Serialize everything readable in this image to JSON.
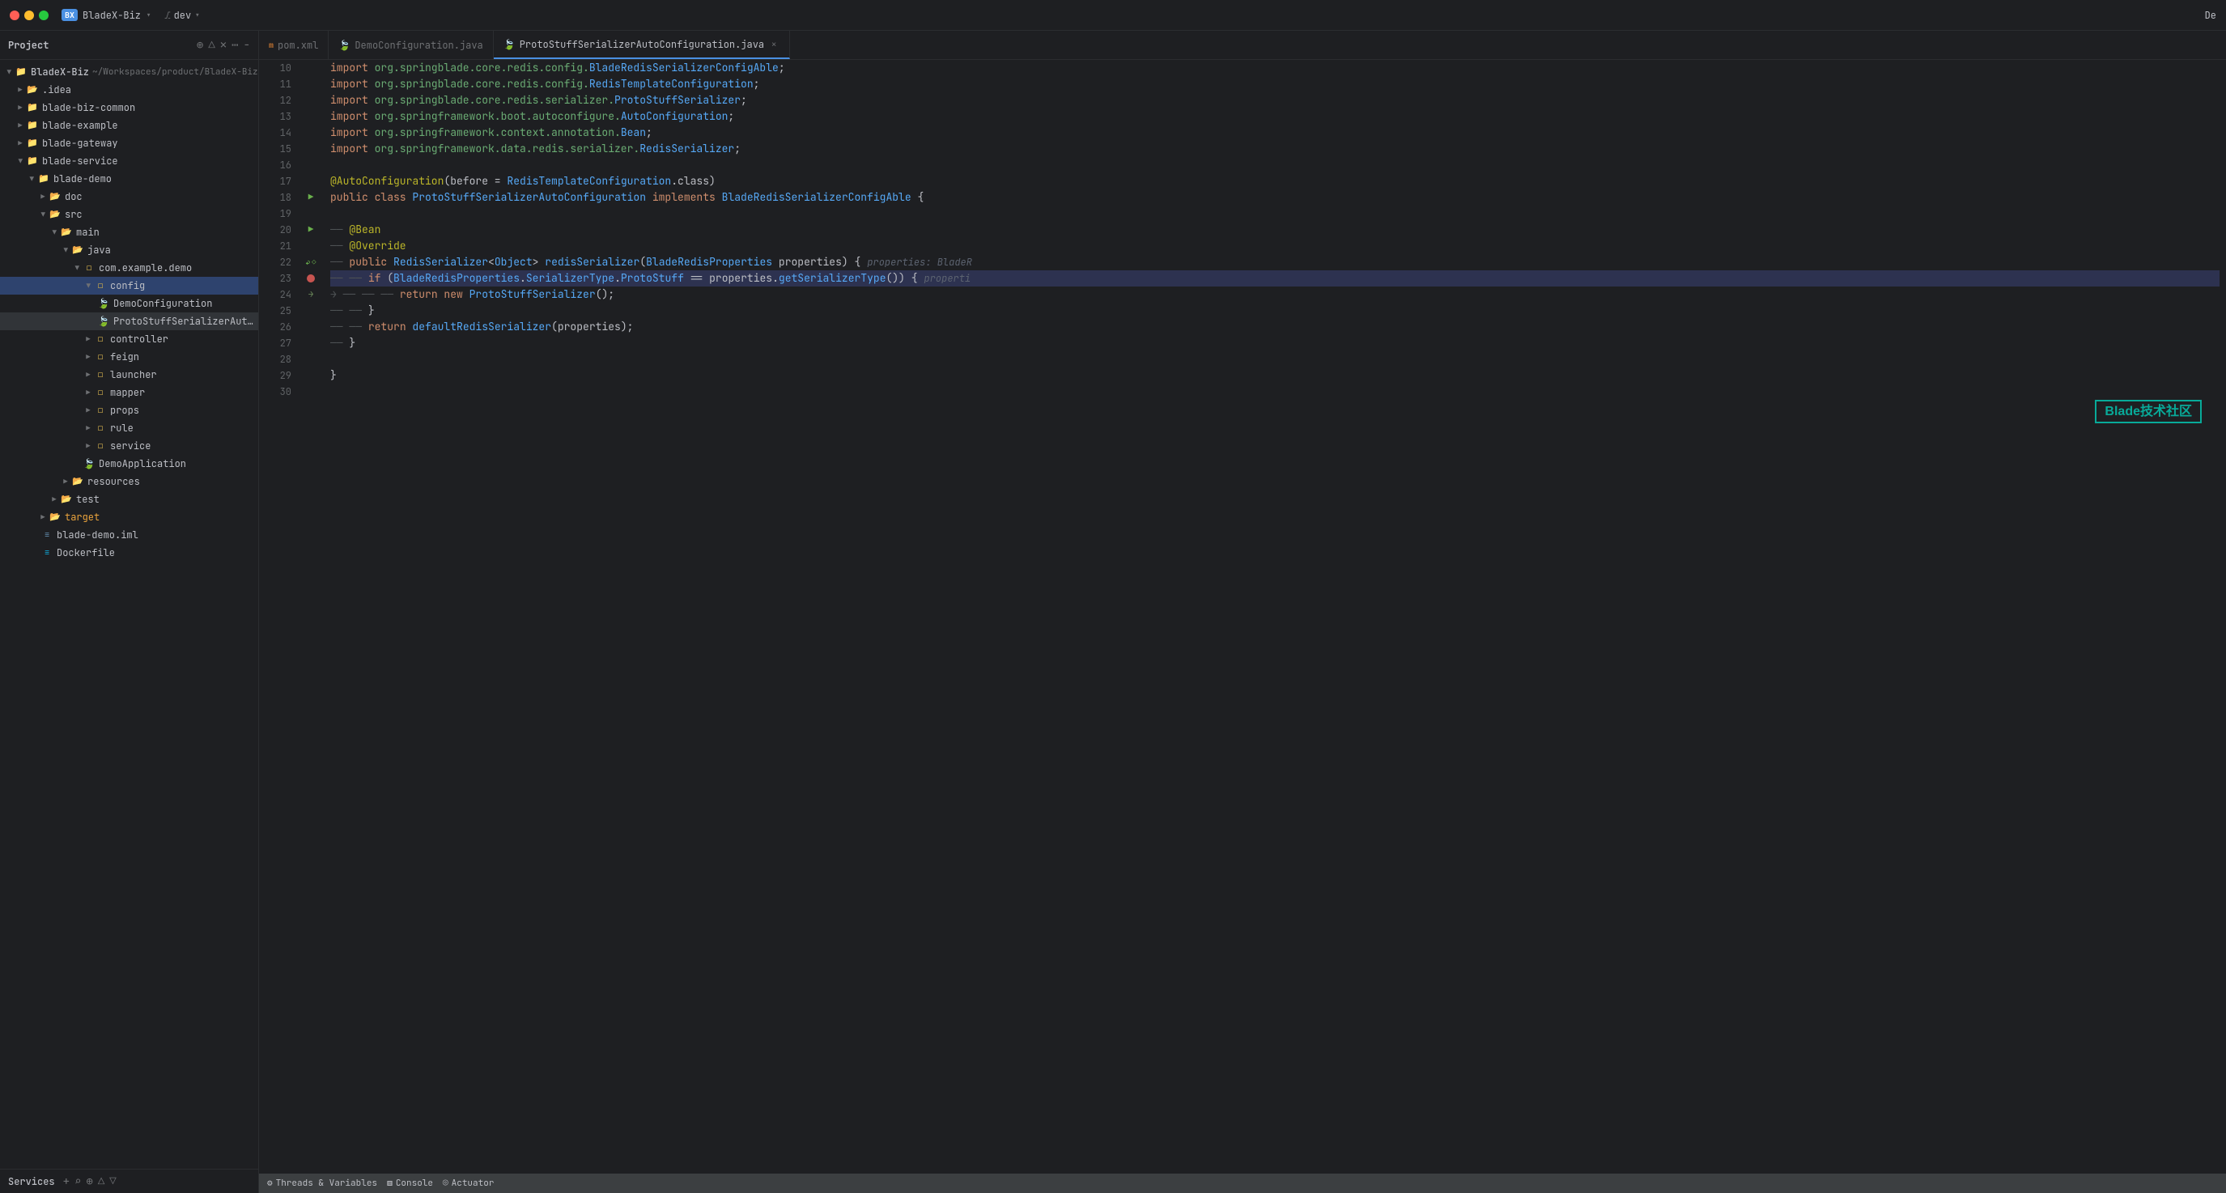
{
  "titlebar": {
    "project_name": "BladeX-Biz",
    "branch": "dev",
    "badge": "BX",
    "right_label": "De"
  },
  "sidebar": {
    "title": "Project",
    "root": {
      "name": "BladeX-Biz",
      "path": "~/Workspaces/product/BladeX-Biz"
    },
    "items": [
      {
        "id": "idea",
        "label": ".idea",
        "type": "folder",
        "depth": 1,
        "expanded": false
      },
      {
        "id": "blade-biz-common",
        "label": "blade-biz-common",
        "type": "module",
        "depth": 1,
        "expanded": false
      },
      {
        "id": "blade-example",
        "label": "blade-example",
        "type": "module",
        "depth": 1,
        "expanded": false
      },
      {
        "id": "blade-gateway",
        "label": "blade-gateway",
        "type": "module",
        "depth": 1,
        "expanded": false
      },
      {
        "id": "blade-service",
        "label": "blade-service",
        "type": "module",
        "depth": 1,
        "expanded": true
      },
      {
        "id": "blade-demo",
        "label": "blade-demo",
        "type": "module",
        "depth": 2,
        "expanded": true
      },
      {
        "id": "doc",
        "label": "doc",
        "type": "folder",
        "depth": 3,
        "expanded": false
      },
      {
        "id": "src",
        "label": "src",
        "type": "folder",
        "depth": 3,
        "expanded": true
      },
      {
        "id": "main",
        "label": "main",
        "type": "folder",
        "depth": 4,
        "expanded": true
      },
      {
        "id": "java",
        "label": "java",
        "type": "folder",
        "depth": 5,
        "expanded": true
      },
      {
        "id": "com.example.demo",
        "label": "com.example.demo",
        "type": "package",
        "depth": 6,
        "expanded": true
      },
      {
        "id": "config",
        "label": "config",
        "type": "package",
        "depth": 7,
        "expanded": true,
        "selected": true
      },
      {
        "id": "DemoConfiguration",
        "label": "DemoConfiguration",
        "type": "spring-java",
        "depth": 8
      },
      {
        "id": "ProtoStuffSerializerAutoConfi",
        "label": "ProtoStuffSerializerAutoConfi",
        "type": "spring-java",
        "depth": 8,
        "active": true
      },
      {
        "id": "controller",
        "label": "controller",
        "type": "package",
        "depth": 7,
        "expanded": false
      },
      {
        "id": "feign",
        "label": "feign",
        "type": "package",
        "depth": 7,
        "expanded": false
      },
      {
        "id": "launcher",
        "label": "launcher",
        "type": "package",
        "depth": 7,
        "expanded": false
      },
      {
        "id": "mapper",
        "label": "mapper",
        "type": "package",
        "depth": 7,
        "expanded": false
      },
      {
        "id": "props",
        "label": "props",
        "type": "package",
        "depth": 7,
        "expanded": false
      },
      {
        "id": "rule",
        "label": "rule",
        "type": "package",
        "depth": 7,
        "expanded": false
      },
      {
        "id": "service",
        "label": "service",
        "type": "package",
        "depth": 7,
        "expanded": false
      },
      {
        "id": "DemoApplication",
        "label": "DemoApplication",
        "type": "spring-java",
        "depth": 7
      },
      {
        "id": "resources",
        "label": "resources",
        "type": "folder",
        "depth": 4,
        "expanded": false
      },
      {
        "id": "test",
        "label": "test",
        "type": "folder",
        "depth": 4,
        "expanded": false
      },
      {
        "id": "target",
        "label": "target",
        "type": "folder",
        "depth": 3,
        "expanded": false,
        "orange": true
      },
      {
        "id": "blade-demo.iml",
        "label": "blade-demo.iml",
        "type": "iml",
        "depth": 3
      },
      {
        "id": "Dockerfile",
        "label": "Dockerfile",
        "type": "docker",
        "depth": 3
      }
    ]
  },
  "tabs": [
    {
      "id": "pom",
      "label": "pom.xml",
      "type": "xml",
      "active": false
    },
    {
      "id": "DemoConfiguration",
      "label": "DemoConfiguration.java",
      "type": "spring",
      "active": false
    },
    {
      "id": "ProtoStuff",
      "label": "ProtoStuffSerializerAutoConfiguration.java",
      "type": "spring",
      "active": true,
      "closable": true
    }
  ],
  "code": {
    "lines": [
      {
        "num": 10,
        "content": "import org.springblade.core.redis.config.BladeRedisSerializerConfigAble;",
        "type": "import"
      },
      {
        "num": 11,
        "content": "import org.springblade.core.redis.config.RedisTemplateConfiguration;",
        "type": "import"
      },
      {
        "num": 12,
        "content": "import org.springblade.core.redis.serializer.ProtoStuffSerializer;",
        "type": "import"
      },
      {
        "num": 13,
        "content": "import org.springframework.boot.autoconfigure.AutoConfiguration;",
        "type": "import"
      },
      {
        "num": 14,
        "content": "import org.springframework.context.annotation.Bean;",
        "type": "import"
      },
      {
        "num": 15,
        "content": "import org.springframework.data.redis.serializer.RedisSerializer;",
        "type": "import"
      },
      {
        "num": 16,
        "content": "",
        "type": "blank"
      },
      {
        "num": 17,
        "content": "@AutoConfiguration(before = RedisTemplateConfiguration.class)",
        "type": "annotation"
      },
      {
        "num": 18,
        "content": "public class ProtoStuffSerializerAutoConfiguration implements BladeRedisSerializerConfigAble {",
        "type": "code"
      },
      {
        "num": 19,
        "content": "",
        "type": "blank"
      },
      {
        "num": 20,
        "content": "    @Bean",
        "type": "annotation",
        "dashes": 1
      },
      {
        "num": 21,
        "content": "    @Override",
        "type": "annotation",
        "dashes": 1
      },
      {
        "num": 22,
        "content": "    public RedisSerializer<Object> redisSerializer(BladeRedisProperties properties) {",
        "type": "code",
        "dashes": 1,
        "hint": "properties: BladeR"
      },
      {
        "num": 23,
        "content": "        if (BladeRedisProperties.SerializerType.ProtoStuff == properties.getSerializerType()) {",
        "type": "code",
        "highlighted": true,
        "dashes": 2,
        "hint": "properti"
      },
      {
        "num": 24,
        "content": "            return new ProtoStuffSerializer();",
        "type": "code",
        "dashes": 3
      },
      {
        "num": 25,
        "content": "        }",
        "type": "code",
        "dashes": 2
      },
      {
        "num": 26,
        "content": "        return defaultRedisSerializer(properties);",
        "type": "code",
        "dashes": 2
      },
      {
        "num": 27,
        "content": "    }",
        "type": "code",
        "dashes": 1
      },
      {
        "num": 28,
        "content": "",
        "type": "blank"
      },
      {
        "num": 29,
        "content": "}",
        "type": "code"
      },
      {
        "num": 30,
        "content": "",
        "type": "blank"
      }
    ]
  },
  "bottom": {
    "services_label": "Services"
  },
  "statusbar": {
    "threads_label": "Threads & Variables",
    "console_label": "Console",
    "actuator_label": "Actuator",
    "watermark": "Blade技术社区"
  }
}
